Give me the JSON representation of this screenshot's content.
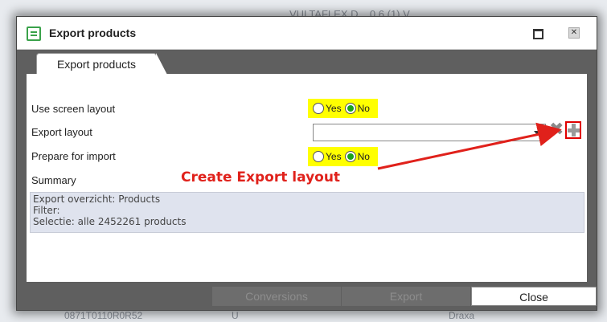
{
  "background": {
    "title": "VULTAFLEX D... 0.6 (1) V",
    "bottom_texts": [
      "0871T0110R0R52",
      "U",
      "Draxa"
    ]
  },
  "dialog": {
    "title": "Export products",
    "tab": "Export products",
    "icons": {
      "title": "list-icon",
      "maximize": "maximize-icon",
      "close": "close-icon"
    }
  },
  "form": {
    "use_screen_layout": {
      "label": "Use screen layout",
      "options": [
        "Yes",
        "No"
      ],
      "selected": "No"
    },
    "export_layout": {
      "label": "Export layout",
      "value": ""
    },
    "prepare_for_import": {
      "label": "Prepare for import",
      "options": [
        "Yes",
        "No"
      ],
      "selected": "No"
    },
    "summary": {
      "label": "Summary",
      "lines": [
        "Export overzicht: Products",
        "Filter:",
        "Selectie: alle 2452261 products"
      ]
    }
  },
  "annotation": {
    "text": "Create Export layout",
    "color": "#e0211b"
  },
  "footer": {
    "conversions": "Conversions",
    "export": "Export",
    "close": "Close"
  },
  "colors": {
    "highlight": "#ffff00",
    "radio_on": "#1aa31a",
    "accent_red": "#e00000"
  }
}
